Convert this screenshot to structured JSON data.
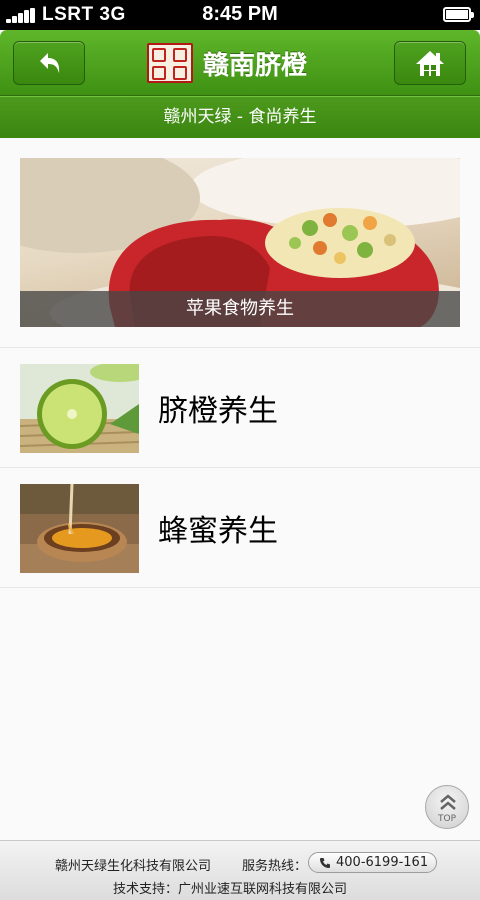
{
  "status_bar": {
    "carrier": "LSRT  3G",
    "time": "8:45 PM"
  },
  "header": {
    "brand_title": "赣南脐橙",
    "back_icon": "back-arrow-icon",
    "home_icon": "home-icon",
    "accent_color": "#4fa21f"
  },
  "subtitle": "赣州天绿 - 食尚养生",
  "banner": {
    "caption": "苹果食物养生"
  },
  "list": [
    {
      "label": "脐橙养生",
      "thumb": "lime-image"
    },
    {
      "label": "蜂蜜养生",
      "thumb": "honey-image"
    }
  ],
  "top_button": {
    "label": "TOP",
    "icon": "double-chevron-up-icon"
  },
  "footer": {
    "company": "赣州天绿生化科技有限公司",
    "hotline_label": "服务热线：",
    "hotline_number": "400-6199-161",
    "phone_icon": "phone-icon",
    "support": "技术支持：广州业速互联网科技有限公司"
  }
}
